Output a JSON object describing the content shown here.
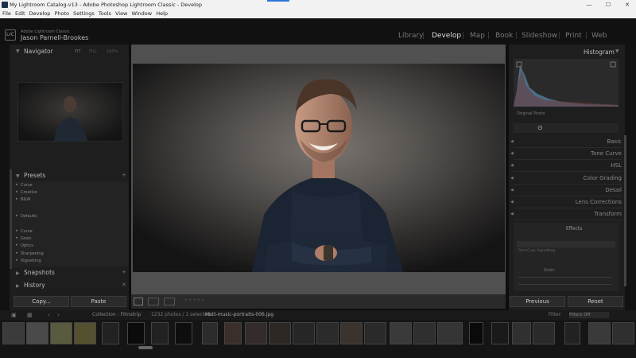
{
  "window": {
    "title": "My Lightroom Catalog-v13 - Adobe Photoshop Lightroom Classic - Develop",
    "controls": {
      "minimize": "—",
      "maximize": "☐",
      "close": "✕"
    }
  },
  "menu": [
    "File",
    "Edit",
    "Develop",
    "Photo",
    "Settings",
    "Tools",
    "View",
    "Window",
    "Help"
  ],
  "identity": {
    "subtitle": "Adobe Lightroom Classic",
    "name": "Jason Parnell-Brookes",
    "logo": "LrC"
  },
  "modules": [
    {
      "label": "Library"
    },
    {
      "label": "Develop"
    },
    {
      "label": "Map"
    },
    {
      "label": "Book"
    },
    {
      "label": "Slideshow"
    },
    {
      "label": "Print"
    },
    {
      "label": "Web"
    }
  ],
  "left_panel": {
    "navigator": {
      "title": "Navigator",
      "zoom": [
        "FIT",
        "FILL",
        "100%"
      ]
    },
    "presets": {
      "title": "Presets",
      "items": [
        "Curve",
        "Creative",
        "B&W",
        "",
        "Defaults",
        "",
        "Curve",
        "Grain",
        "Optics",
        "Sharpening",
        "Vignetting"
      ]
    },
    "snapshots": {
      "title": "Snapshots"
    },
    "history": {
      "title": "History"
    },
    "copy_button": "Copy...",
    "paste_button": "Paste"
  },
  "right_panel": {
    "histogram_title": "Histogram",
    "original_photo_label": "Original Photo",
    "sections": [
      "Basic",
      "Tone Curve",
      "HSL",
      "Color Grading",
      "Detail",
      "Lens Corrections",
      "Transform"
    ],
    "effects": {
      "title": "Effects",
      "sub_label": "Post-Crop Vignetting",
      "grain_label": "Grain"
    },
    "previous_button": "Previous",
    "reset_button": "Reset"
  },
  "filmstrip": {
    "source": "Collection : Filmstrip",
    "count": "1232 photos / 1 selected",
    "filename": "Matt-music-portraits-006.jpg",
    "filter_label": "Filter:",
    "filter_value": "Filters Off"
  },
  "colors": {
    "accent": "#2f76d8",
    "panel": "#1e1e1e",
    "canvas": "#505050"
  }
}
